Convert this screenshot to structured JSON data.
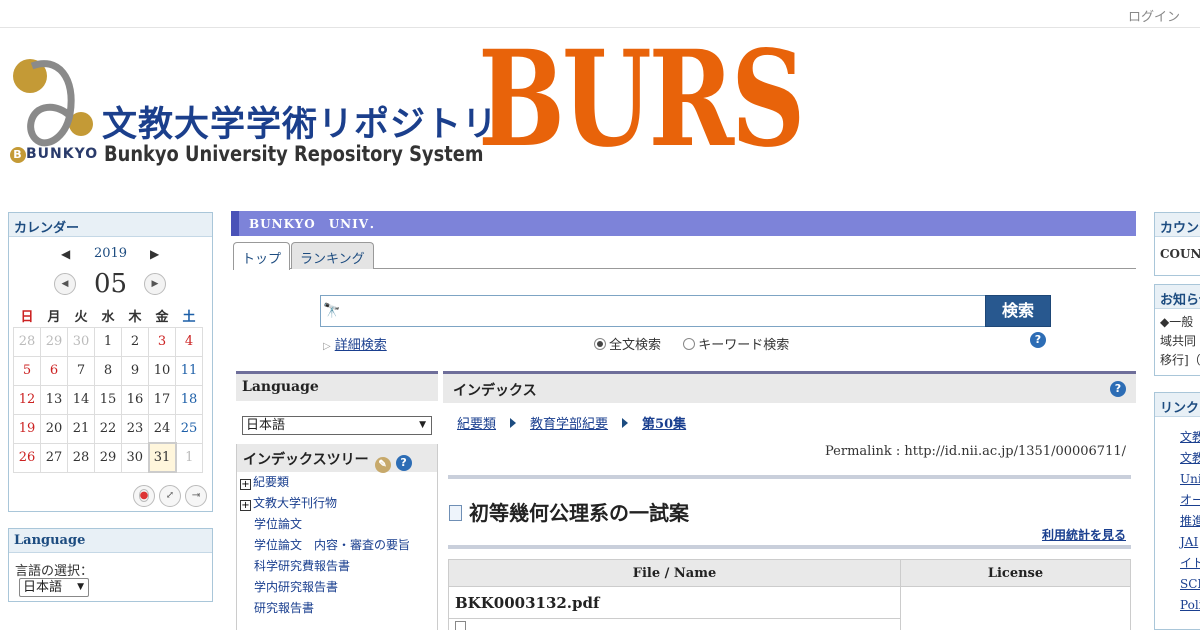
{
  "header": {
    "login": "ログイン",
    "logo_kanji": "文教大学学術リポジトリ",
    "logo_english": "Bunkyo University Repository System",
    "logo_bunkyo": "BUNKYO",
    "logo_burs": "BURS"
  },
  "calendar": {
    "title": "カレンダー",
    "year": "2019",
    "month": "05",
    "weekdays": [
      "日",
      "月",
      "火",
      "水",
      "木",
      "金",
      "土"
    ],
    "weeks": [
      [
        "28",
        "29",
        "30",
        "1",
        "2",
        "3",
        "4"
      ],
      [
        "5",
        "6",
        "7",
        "8",
        "9",
        "10",
        "11"
      ],
      [
        "12",
        "13",
        "14",
        "15",
        "16",
        "17",
        "18"
      ],
      [
        "19",
        "20",
        "21",
        "22",
        "23",
        "24",
        "25"
      ],
      [
        "26",
        "27",
        "28",
        "29",
        "30",
        "31",
        "1"
      ]
    ]
  },
  "language_left": {
    "title": "Language",
    "label": "言語の選択：",
    "selected": "日本語"
  },
  "banner": "BUNKYO　UNIV．",
  "tabs": [
    "トップ",
    "ランキング"
  ],
  "search": {
    "button": "検索",
    "advanced": "詳細検索",
    "option_full": "全文検索",
    "option_keyword": "キーワード検索"
  },
  "language_panel": {
    "title": "Language",
    "selected": "日本語"
  },
  "index_tree": {
    "title": "インデックスツリー",
    "items": [
      {
        "label": "紀要類",
        "expandable": true
      },
      {
        "label": "文教大学刊行物",
        "expandable": true
      },
      {
        "label": "学位論文",
        "expandable": false
      },
      {
        "label": "学位論文　内容・審査の要旨",
        "expandable": false
      },
      {
        "label": "科学研究費報告書",
        "expandable": false
      },
      {
        "label": "学内研究報告書",
        "expandable": false
      },
      {
        "label": "研究報告書",
        "expandable": false
      }
    ]
  },
  "index": {
    "title": "インデックス",
    "breadcrumbs": [
      "紀要類",
      "教育学部紀要",
      "第50集"
    ],
    "permalink": "Permalink : http://id.nii.ac.jp/1351/00006711/",
    "item_title": "初等幾何公理系の一試案",
    "stats_link": "利用統計を見る",
    "table_headers": [
      "File / Name",
      "License"
    ],
    "file_name": "BKK0003132.pdf"
  },
  "right": {
    "counter_title": "カウンタ",
    "counter_text": "COUNT",
    "notice_title": "お知らせ",
    "notice_lines": [
      "◆一般",
      "域共同",
      "移行]（"
    ],
    "links_title": "リンク",
    "links": [
      "文教",
      "文教",
      "Uni",
      "オー",
      "推進",
      "JAI",
      "イト",
      "SCP",
      "Poli"
    ]
  }
}
